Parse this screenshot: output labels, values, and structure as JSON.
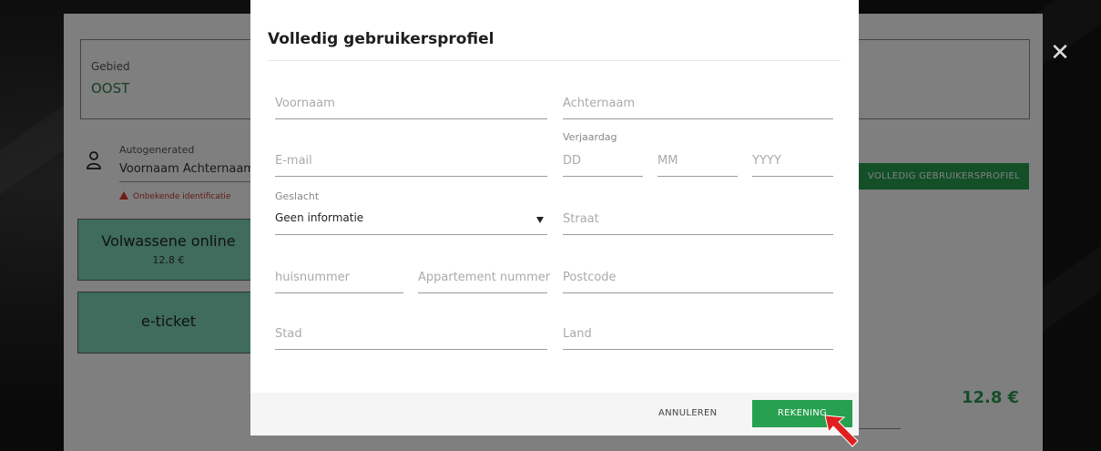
{
  "background": {
    "gebied_label": "Gebied",
    "gebied_value": "OOST",
    "user": {
      "type_label": "Autogenerated",
      "name": "Voornaam Achternaam",
      "warning": "Onbekende identificatie"
    },
    "tickets": [
      {
        "title": "Volwassene online",
        "price": "12.8 €"
      },
      {
        "title": "e-ticket"
      }
    ],
    "profile_button": "VOLLEDIG GEBRUIKERSPROFIEL",
    "total": "12.8 €",
    "close_icon": "close-icon"
  },
  "modal": {
    "title": "Volledig gebruikersprofiel",
    "fields": {
      "voornaam": {
        "placeholder": "Voornaam"
      },
      "achternaam": {
        "placeholder": "Achternaam"
      },
      "email": {
        "placeholder": "E-mail"
      },
      "verjaardag": {
        "label": "Verjaardag",
        "dd": "DD",
        "mm": "MM",
        "yyyy": "YYYY"
      },
      "geslacht": {
        "label": "Geslacht",
        "value": "Geen informatie"
      },
      "straat": {
        "placeholder": "Straat"
      },
      "huisnummer": {
        "placeholder": "huisnummer"
      },
      "appartement": {
        "placeholder": "Appartement nummer"
      },
      "postcode": {
        "placeholder": "Postcode"
      },
      "stad": {
        "placeholder": "Stad"
      },
      "land": {
        "placeholder": "Land"
      }
    },
    "buttons": {
      "cancel": "ANNULEREN",
      "submit": "REKENING"
    }
  },
  "colors": {
    "accent_green": "#27a050",
    "ticket_green": "#7ed8b8",
    "warning_red": "#e03c2e",
    "cursor_red": "#e02020"
  }
}
